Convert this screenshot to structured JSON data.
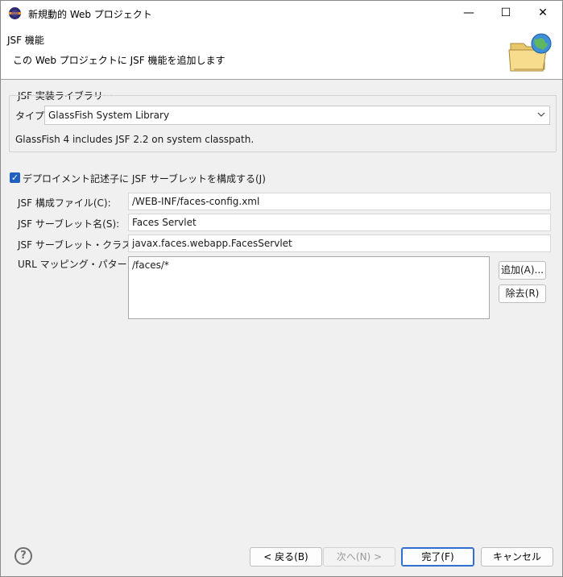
{
  "window": {
    "title": "新規動的 Web プロジェクト",
    "minimize": "—",
    "maximize": "☐",
    "close": "✕"
  },
  "banner": {
    "title": "JSF 機能",
    "description": "この Web プロジェクトに JSF 機能を追加します",
    "image_icon": "web-project-folder-globe-icon"
  },
  "implementation_library": {
    "group_title": "JSF 実装ライブラリー",
    "type_label": "タイプ:",
    "type_value": "GlassFish System Library",
    "description": "GlassFish 4 includes JSF 2.2 on system classpath."
  },
  "deployment": {
    "checkbox_label": "デプロイメント記述子に JSF サーブレットを構成する(J)",
    "checked": true
  },
  "fields": {
    "config_file_label": "JSF 構成ファイル(C):",
    "config_file_value": "/WEB-INF/faces-config.xml",
    "servlet_name_label": "JSF サーブレット名(S):",
    "servlet_name_value": "Faces Servlet",
    "servlet_class_label": "JSF サーブレット・クラス名(L):",
    "servlet_class_value": "javax.faces.webapp.FacesServlet",
    "url_mapping_label": "URL マッピング・パターン(U):",
    "url_mappings": [
      "/faces/*"
    ],
    "add_button": "追加(A)...",
    "remove_button": "除去(R)"
  },
  "footer": {
    "help_icon": "?",
    "back": "< 戻る(B)",
    "next": "次へ(N) >",
    "finish": "完了(F)",
    "cancel": "キャンセル"
  },
  "colors": {
    "accent": "#1f5fbf",
    "default_button_border": "#2f6fcf"
  }
}
